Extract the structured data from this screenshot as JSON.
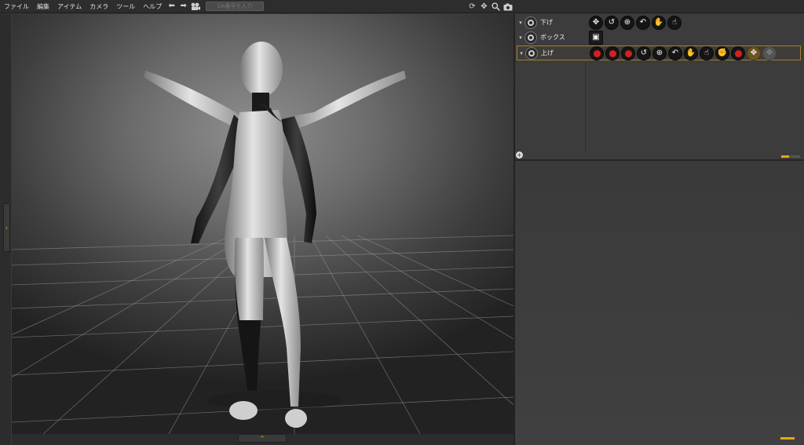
{
  "menubar": {
    "items": [
      "ファイル",
      "編集",
      "アイテム",
      "カメラ",
      "ツール",
      "ヘルプ"
    ],
    "search_placeholder": "DA番号を入力",
    "nav_icons": [
      "arrow-left-icon",
      "arrow-right-icon",
      "camera-rig-icon"
    ],
    "right_icons": [
      "refresh-icon",
      "move-icon",
      "zoom-icon",
      "camera-icon"
    ]
  },
  "left_handle": {
    "glyph": "›"
  },
  "bottom_handle": {
    "glyph": "^"
  },
  "panel": {
    "rows": [
      {
        "arrow": "▾",
        "label": "下げ",
        "selected": false
      },
      {
        "arrow": "▾",
        "label": "ボックス",
        "selected": false
      },
      {
        "arrow": "▾",
        "label": "上げ",
        "selected": true
      }
    ],
    "add_glyph": "+"
  },
  "colors": {
    "accent": "#e8a800",
    "red": "#d62020",
    "selection_border": "#a57f2e"
  }
}
